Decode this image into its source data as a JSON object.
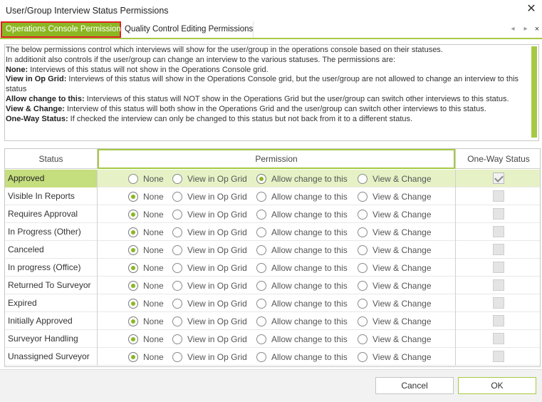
{
  "window": {
    "title": "User/Group Interview Status Permissions",
    "close_icon": "close-icon"
  },
  "tabs": [
    {
      "label": "Operations Console Permission",
      "active": true
    },
    {
      "label": "Quality Control Editing Permissions",
      "active": false
    }
  ],
  "tab_nav": {
    "prev": "◂",
    "next": "▸",
    "close": "×"
  },
  "info": {
    "line1": "The below permissions control which interviews will show for the user/group in the operations console based on their statuses.",
    "line2": "In additionit also controls if the user/group can change an interview to the various statuses. The permissions are:",
    "items": [
      {
        "term": "None:",
        "text": " Interviews of this status will not show in the Operations Console grid."
      },
      {
        "term": "View in Op Grid:",
        "text": " Interviews of this status will show in the Operations Console grid, but the user/group are not allowed to change an interview to this status"
      },
      {
        "term": "Allow change to this:",
        "text": " Interviews of this status will NOT show in the Operations Grid but the user/group can switch other interviews to this status."
      },
      {
        "term": "View & Change:",
        "text": " Interview of this status will both show in the Operations Grid and the user/group can switch other interviews to this status."
      },
      {
        "term": "One-Way Status:",
        "text": " If checked the interview can only be changed to this status but not back from it to a different status."
      }
    ]
  },
  "grid": {
    "headers": {
      "status": "Status",
      "permission": "Permission",
      "one_way": "One-Way Status"
    },
    "options": [
      "None",
      "View in Op Grid",
      "Allow change to this",
      "View & Change"
    ],
    "rows": [
      {
        "status": "Approved",
        "selected": 2,
        "one_way": true,
        "highlight": true
      },
      {
        "status": "Visible In Reports",
        "selected": 0,
        "one_way": false,
        "highlight": false
      },
      {
        "status": "Requires Approval",
        "selected": 0,
        "one_way": false,
        "highlight": false
      },
      {
        "status": "In Progress (Other)",
        "selected": 0,
        "one_way": false,
        "highlight": false
      },
      {
        "status": "Canceled",
        "selected": 0,
        "one_way": false,
        "highlight": false
      },
      {
        "status": "In progress (Office)",
        "selected": 0,
        "one_way": false,
        "highlight": false
      },
      {
        "status": "Returned To Surveyor",
        "selected": 0,
        "one_way": false,
        "highlight": false
      },
      {
        "status": "Expired",
        "selected": 0,
        "one_way": false,
        "highlight": false
      },
      {
        "status": "Initially Approved",
        "selected": 0,
        "one_way": false,
        "highlight": false
      },
      {
        "status": "Surveyor Handling",
        "selected": 0,
        "one_way": false,
        "highlight": false
      },
      {
        "status": "Unassigned Surveyor",
        "selected": 0,
        "one_way": false,
        "highlight": false
      }
    ]
  },
  "footer": {
    "cancel": "Cancel",
    "ok": "OK"
  },
  "colors": {
    "accent": "#8bb723",
    "accent_light": "#a6c945",
    "selected_row": "#e6f2c6",
    "active_tab_border": "#e02020"
  }
}
